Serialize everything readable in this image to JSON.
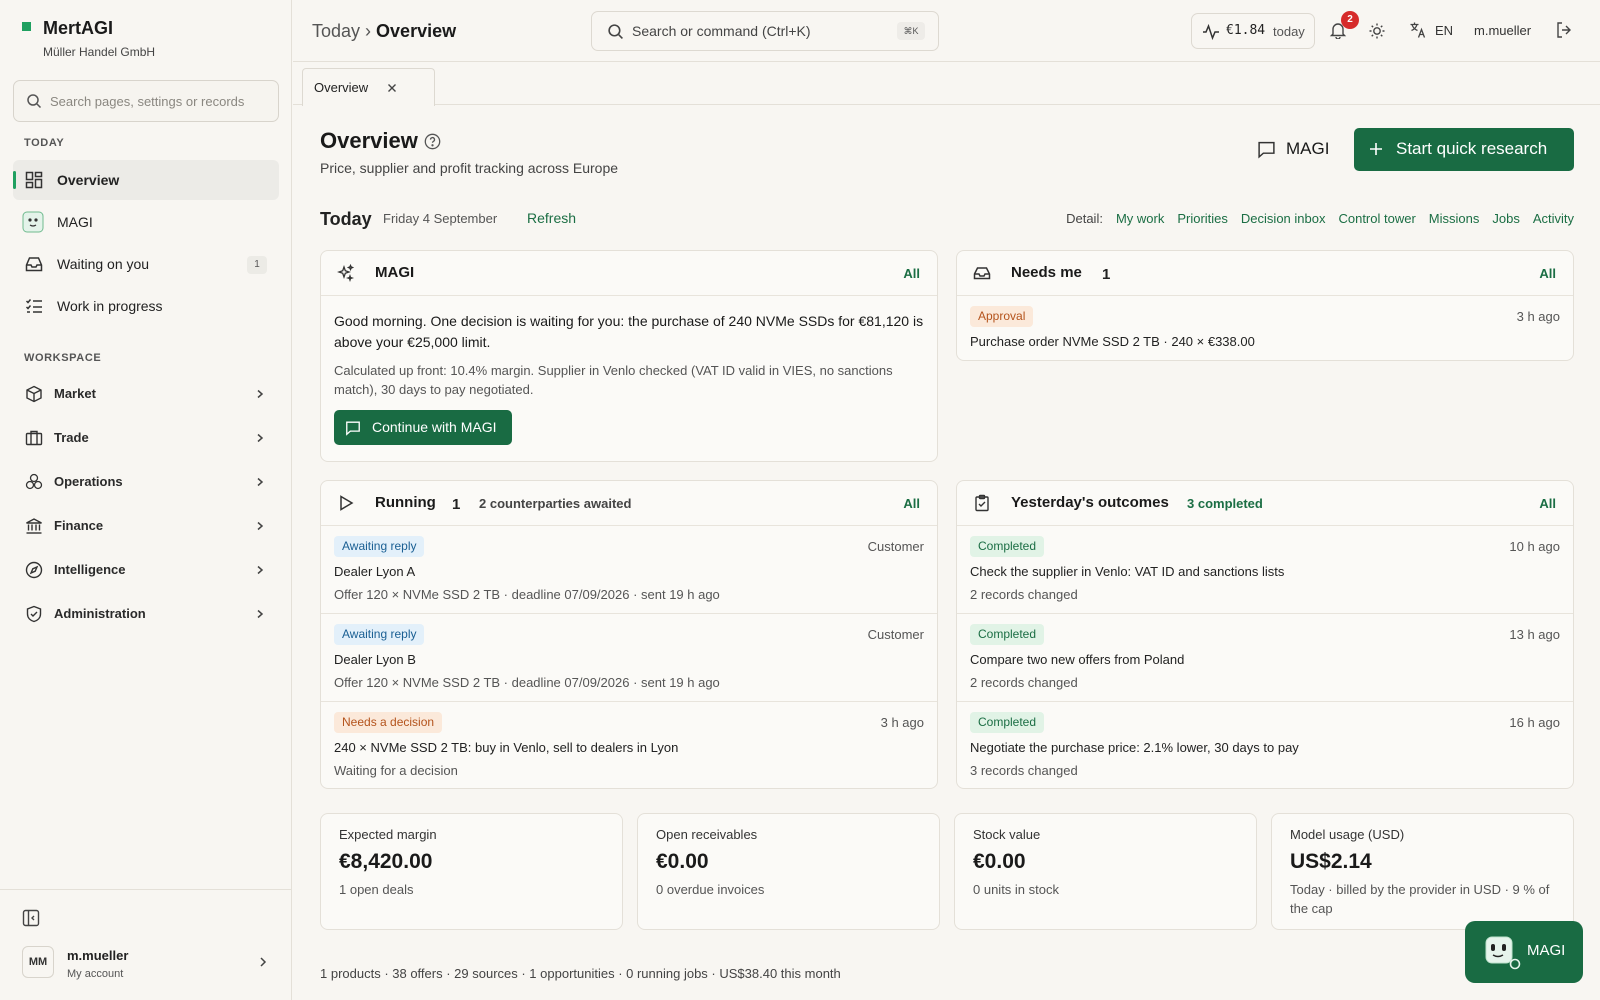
{
  "brand": {
    "name": "MertAGI",
    "org": "Müller Handel GmbH"
  },
  "sidebar": {
    "search_placeholder": "Search pages, settings or records",
    "section_today": "TODAY",
    "today_items": [
      {
        "label": "Overview",
        "icon": "dashboard-icon",
        "active": true
      },
      {
        "label": "MAGI",
        "icon": "magi-face-icon"
      },
      {
        "label": "Waiting on you",
        "icon": "inbox-icon",
        "badge": "1"
      },
      {
        "label": "Work in progress",
        "icon": "checklist-icon"
      }
    ],
    "section_workspace": "WORKSPACE",
    "workspace_items": [
      {
        "label": "Market",
        "icon": "cube-icon"
      },
      {
        "label": "Trade",
        "icon": "briefcase-icon"
      },
      {
        "label": "Operations",
        "icon": "boxes-icon"
      },
      {
        "label": "Finance",
        "icon": "bank-icon"
      },
      {
        "label": "Intelligence",
        "icon": "compass-icon"
      },
      {
        "label": "Administration",
        "icon": "shield-icon"
      }
    ],
    "user": {
      "initials": "MM",
      "name": "m.mueller",
      "sub": "My account"
    }
  },
  "topbar": {
    "crumb_parent": "Today",
    "crumb_sep": "›",
    "crumb_current": "Overview",
    "search_placeholder": "Search or command (Ctrl+K)",
    "search_kbd": "⌘K",
    "cost_amount": "€1.84",
    "cost_label": "today",
    "notifications": "2",
    "lang": "EN",
    "user": "m.mueller"
  },
  "tabs": [
    {
      "label": "Overview"
    }
  ],
  "page": {
    "title": "Overview",
    "subtitle": "Price, supplier and profit tracking across Europe",
    "magi_button": "MAGI",
    "quick_research": "Start quick research",
    "today_label": "Today",
    "today_date": "Friday 4 September",
    "refresh": "Refresh",
    "detail_label": "Detail:",
    "detail_links": [
      "My work",
      "Priorities",
      "Decision inbox",
      "Control tower",
      "Missions",
      "Jobs",
      "Activity"
    ]
  },
  "magi_card": {
    "title": "MAGI",
    "all": "All",
    "message": "Good morning. One decision is waiting for you: the purchase of 240 NVMe SSDs for €81,120 is above your €25,000 limit.",
    "detail": "Calculated up front: 10.4% margin. Supplier in Venlo checked (VAT ID valid in VIES, no sanctions match), 30 days to pay negotiated.",
    "button": "Continue with MAGI"
  },
  "needs_me": {
    "title": "Needs me",
    "count": "1",
    "all": "All",
    "items": [
      {
        "status": "Approval",
        "time": "3 h ago",
        "text": "Purchase order NVMe SSD 2 TB · 240 × €338.00"
      }
    ]
  },
  "running": {
    "title": "Running",
    "count": "1",
    "sub": "2 counterparties awaited",
    "all": "All",
    "items": [
      {
        "status": "Awaiting reply",
        "right": "Customer",
        "title": "Dealer Lyon A",
        "detail": "Offer 120 × NVMe SSD 2 TB · deadline 07/09/2026 · sent 19 h ago"
      },
      {
        "status": "Awaiting reply",
        "right": "Customer",
        "title": "Dealer Lyon B",
        "detail": "Offer 120 × NVMe SSD 2 TB · deadline 07/09/2026 · sent 19 h ago"
      },
      {
        "status": "Needs a decision",
        "right": "3 h ago",
        "title": "240 × NVMe SSD 2 TB: buy in Venlo, sell to dealers in Lyon",
        "detail": "Waiting for a decision"
      }
    ]
  },
  "outcomes": {
    "title": "Yesterday's outcomes",
    "sub": "3 completed",
    "all": "All",
    "items": [
      {
        "status": "Completed",
        "time": "10 h ago",
        "title": "Check the supplier in Venlo: VAT ID and sanctions lists",
        "detail": "2 records changed"
      },
      {
        "status": "Completed",
        "time": "13 h ago",
        "title": "Compare two new offers from Poland",
        "detail": "2 records changed"
      },
      {
        "status": "Completed",
        "time": "16 h ago",
        "title": "Negotiate the purchase price: 2.1% lower, 30 days to pay",
        "detail": "3 records changed"
      }
    ]
  },
  "kpis": [
    {
      "label": "Expected margin",
      "value": "€8,420.00",
      "sub": "1 open deals"
    },
    {
      "label": "Open receivables",
      "value": "€0.00",
      "sub": "0 overdue invoices"
    },
    {
      "label": "Stock value",
      "value": "€0.00",
      "sub": "0 units in stock"
    },
    {
      "label": "Model usage (USD)",
      "value": "US$2.14",
      "sub": "Today · billed by the provider in USD · 9 % of the cap"
    }
  ],
  "footer": "1 products · 38 offers · 29 sources · 1 opportunities · 0 running jobs · US$38.40 this month",
  "fab": {
    "label": "MAGI"
  },
  "colors": {
    "accent": "#196b43",
    "brand_dot": "#1fa060",
    "badge_red": "#d62b2b"
  }
}
